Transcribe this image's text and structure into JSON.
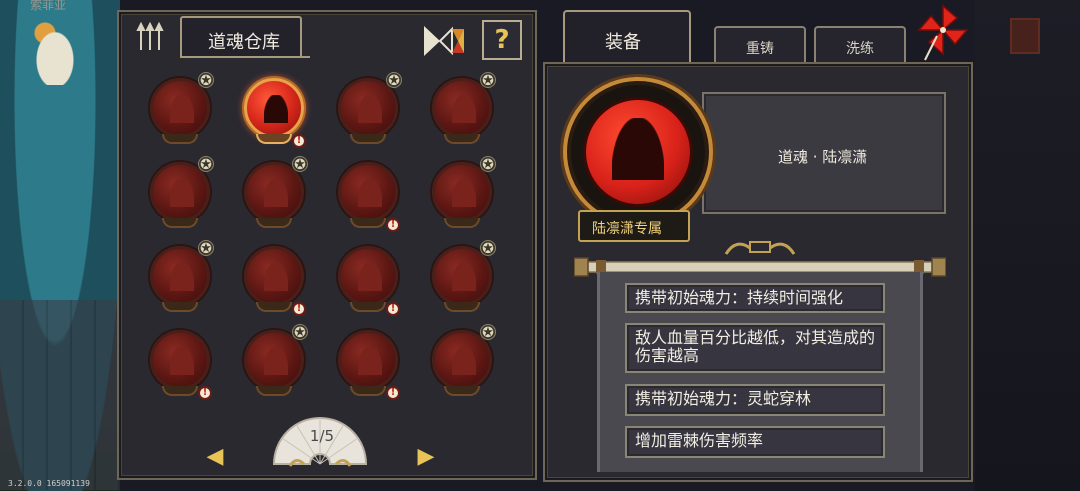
{
  "background": {
    "top_name": "索菲亚"
  },
  "version_text": "3.2.0.0 165091139",
  "warehouse": {
    "title": "道魂仓库",
    "help_label": "?",
    "pager": {
      "label": "1/5",
      "prev": "◀",
      "next": "▶"
    },
    "souls": [
      {
        "row": 0,
        "col": 0,
        "star": true,
        "alert": false,
        "active": false
      },
      {
        "row": 0,
        "col": 1,
        "star": false,
        "alert": true,
        "active": true
      },
      {
        "row": 0,
        "col": 2,
        "star": true,
        "alert": false,
        "active": false
      },
      {
        "row": 0,
        "col": 3,
        "star": true,
        "alert": false,
        "active": false
      },
      {
        "row": 1,
        "col": 0,
        "star": true,
        "alert": false,
        "active": false
      },
      {
        "row": 1,
        "col": 1,
        "star": true,
        "alert": false,
        "active": false
      },
      {
        "row": 1,
        "col": 2,
        "star": false,
        "alert": true,
        "active": false
      },
      {
        "row": 1,
        "col": 3,
        "star": true,
        "alert": false,
        "active": false
      },
      {
        "row": 2,
        "col": 0,
        "star": true,
        "alert": false,
        "active": false
      },
      {
        "row": 2,
        "col": 1,
        "star": false,
        "alert": true,
        "active": false
      },
      {
        "row": 2,
        "col": 2,
        "star": false,
        "alert": true,
        "active": false
      },
      {
        "row": 2,
        "col": 3,
        "star": true,
        "alert": false,
        "active": false
      },
      {
        "row": 3,
        "col": 0,
        "star": false,
        "alert": true,
        "active": false
      },
      {
        "row": 3,
        "col": 1,
        "star": true,
        "alert": false,
        "active": false
      },
      {
        "row": 3,
        "col": 2,
        "star": false,
        "alert": true,
        "active": false
      },
      {
        "row": 3,
        "col": 3,
        "star": true,
        "alert": false,
        "active": false
      }
    ],
    "star_glyph": "✪",
    "alert_glyph": "!"
  },
  "tabs": {
    "equip": "装备",
    "recast": "重铸",
    "refine": "洗练"
  },
  "detail": {
    "name": "道魂 · 陆凛潇",
    "exclusive": "陆凛潇专属",
    "effects": [
      "携带初始魂力：持续时间强化",
      "敌人血量百分比越低，对其造成的伤害越高",
      "携带初始魂力：灵蛇穿林",
      "增加雷棘伤害频率"
    ]
  },
  "colors": {
    "accent_gold": "#e8c458",
    "active_orb": "#d8281c",
    "panel_bg": "#2a2930"
  }
}
